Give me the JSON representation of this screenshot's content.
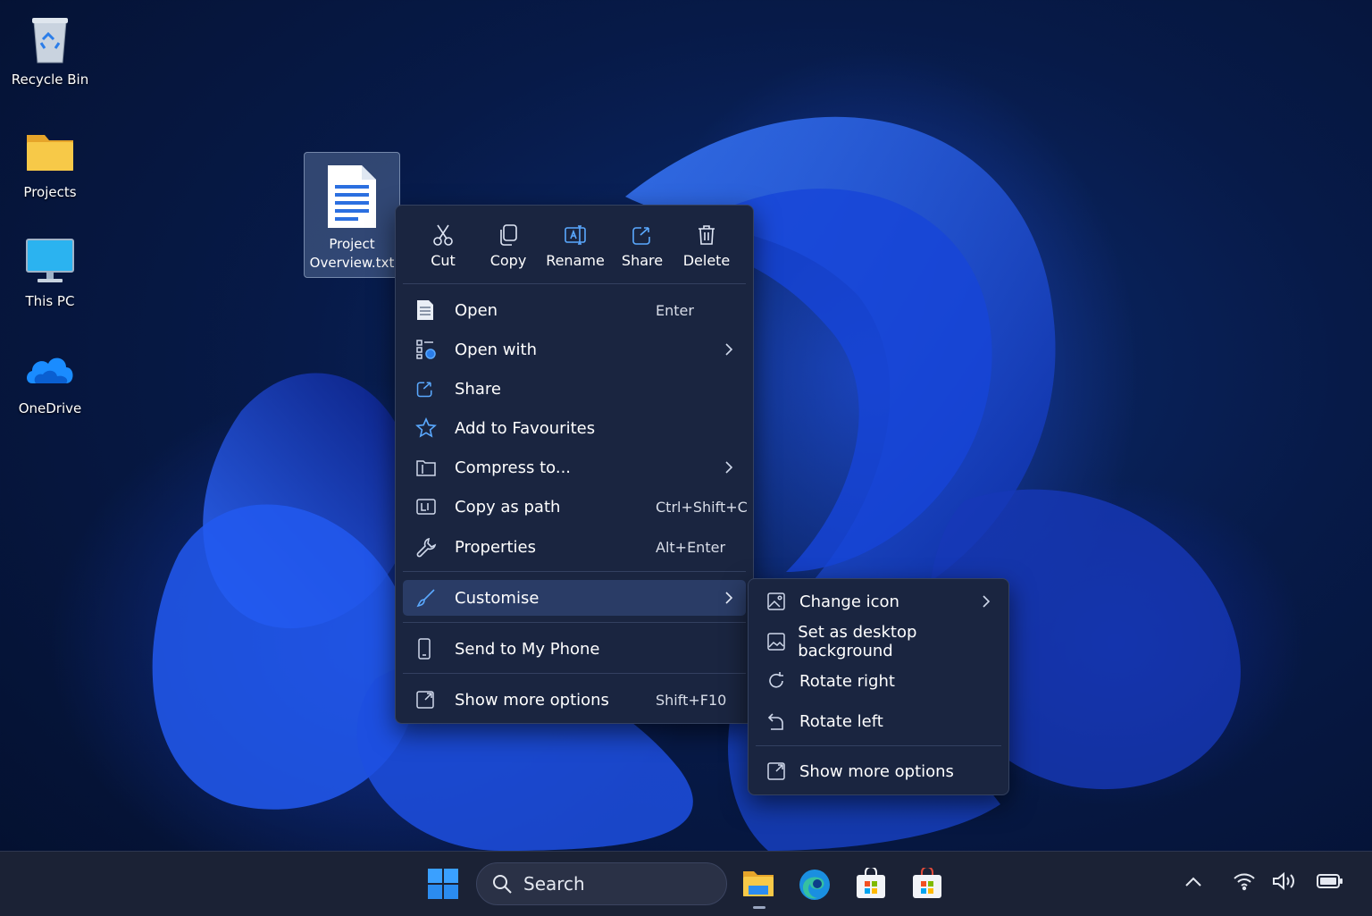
{
  "desktop": {
    "icons": [
      {
        "label": "Recycle Bin",
        "icon": "recycle-bin-icon"
      },
      {
        "label": "Projects",
        "icon": "folder-icon"
      },
      {
        "label": "This PC",
        "icon": "monitor-icon"
      },
      {
        "label": "OneDrive",
        "icon": "cloud-icon"
      }
    ],
    "selected_file": {
      "label_line1": "Project",
      "label_line2": "Overview.txt",
      "icon": "text-document-icon"
    }
  },
  "context_menu": {
    "toolbar": [
      {
        "label": "Cut",
        "icon": "scissors-icon"
      },
      {
        "label": "Copy",
        "icon": "copy-icon"
      },
      {
        "label": "Rename",
        "icon": "rename-icon"
      },
      {
        "label": "Share",
        "icon": "share-icon"
      },
      {
        "label": "Delete",
        "icon": "trash-icon"
      }
    ],
    "items": [
      {
        "label": "Open",
        "shortcut": "Enter",
        "icon": "document-icon"
      },
      {
        "label": "Open with",
        "shortcut": "",
        "icon": "open-with-icon",
        "submenu": true
      },
      {
        "label": "Share",
        "shortcut": "",
        "icon": "share-icon"
      },
      {
        "label": "Add to Favourites",
        "shortcut": "",
        "icon": "star-icon"
      },
      {
        "label": "Compress to...",
        "shortcut": "",
        "icon": "archive-folder-icon",
        "submenu": true
      },
      {
        "label": "Copy as path",
        "shortcut": "Ctrl+Shift+C",
        "icon": "copy-path-icon"
      },
      {
        "label": "Properties",
        "shortcut": "Alt+Enter",
        "icon": "wrench-icon"
      },
      {
        "label": "Customise",
        "shortcut": "",
        "icon": "brush-icon",
        "submenu": true,
        "highlighted": true
      },
      {
        "label": "Send to My Phone",
        "shortcut": "",
        "icon": "phone-icon"
      },
      {
        "label": "Show more options",
        "shortcut": "Shift+F10",
        "icon": "expand-icon"
      }
    ]
  },
  "submenu": {
    "items": [
      {
        "label": "Change icon",
        "icon": "image-icon",
        "submenu": true
      },
      {
        "label": "Set as desktop background",
        "icon": "image-icon"
      },
      {
        "label": "Rotate right",
        "icon": "rotate-right-icon"
      },
      {
        "label": "Rotate left",
        "icon": "rotate-left-icon"
      },
      {
        "label": "Show more options",
        "icon": "expand-icon"
      }
    ]
  },
  "taskbar": {
    "search_placeholder": "Search",
    "apps": [
      "start-icon",
      "file-explorer-icon",
      "edge-icon",
      "store-icon",
      "store-icon"
    ],
    "tray": [
      "chevron-up-icon",
      "wifi-icon",
      "volume-icon",
      "battery-icon"
    ]
  },
  "colors": {
    "accent": "#3b8bff",
    "menu_bg": "#1a2540",
    "highlight": "#2a3c66",
    "taskbar_bg": "#1b2235"
  }
}
